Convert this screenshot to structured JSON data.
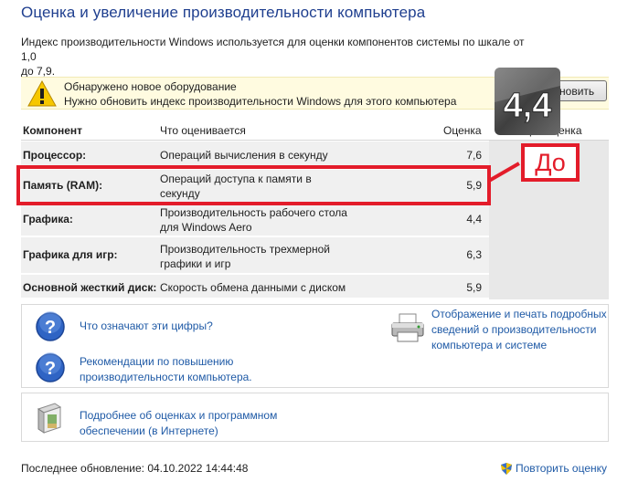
{
  "header": {
    "title": "Оценка и увеличение производительности компьютера",
    "description_line1": "Индекс производительности Windows используется для оценки компонентов системы по шкале от 1,0",
    "description_line2": "до 7,9."
  },
  "notice": {
    "line1": "Обнаружено новое оборудование",
    "line2": "Нужно обновить индекс производительности Windows для этого компьютера",
    "button_label": "Обновить",
    "icon": "warning-icon"
  },
  "table": {
    "headers": {
      "component": "Компонент",
      "rated": "Что оценивается",
      "score": "Оценка",
      "overall": "Общая оценка"
    },
    "rows": [
      {
        "component": "Процессор:",
        "rated_line1": "Операций вычисления в секунду",
        "rated_line2": "",
        "score": "7,6"
      },
      {
        "component": "Память (RAM):",
        "rated_line1": "Операций доступа к памяти в",
        "rated_line2": "секунду",
        "score": "5,9"
      },
      {
        "component": "Графика:",
        "rated_line1": "Производительность рабочего стола",
        "rated_line2": "для Windows Aero",
        "score": "4,4"
      },
      {
        "component": "Графика для игр:",
        "rated_line1": "Производительность трехмерной",
        "rated_line2": "графики и игр",
        "score": "6,3"
      },
      {
        "component": "Основной жесткий диск:",
        "rated_line1": "Скорость обмена данными с диском",
        "rated_line2": "",
        "score": "5,9"
      }
    ],
    "base_score": "4,4"
  },
  "annotation": {
    "label": "До",
    "color": "#e31c2a"
  },
  "links": {
    "what_numbers": "Что означают эти цифры?",
    "tips_line1": "Рекомендации по повышению",
    "tips_line2": "производительности компьютера.",
    "print_line1": "Отображение и печать подробных",
    "print_line2": "сведений о производительности",
    "print_line3": "компьютера и системе",
    "online_line1": "Подробнее об оценках и программном",
    "online_line2": "обеспечении (в Интернете)"
  },
  "footer": {
    "last_update": "Последнее обновление: 04.10.2022 14:44:48",
    "rerun": "Повторить оценку"
  },
  "colors": {
    "title": "#1f3f8f",
    "link": "#1f5aa6",
    "notice_bg": "#fffbe0",
    "row_bg": "#f0f0f0"
  }
}
